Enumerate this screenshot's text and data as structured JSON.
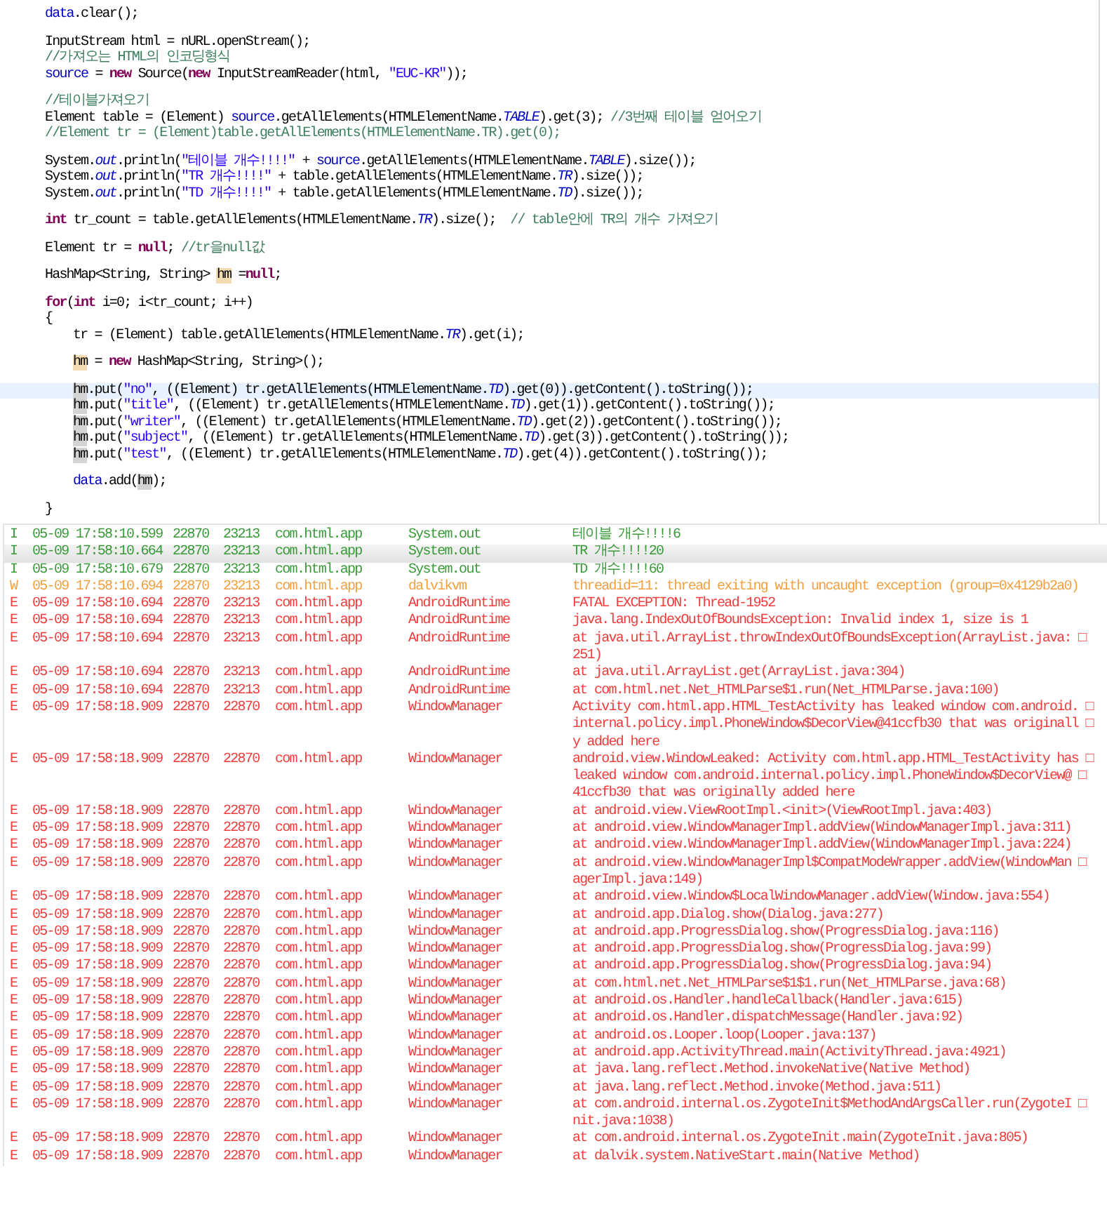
{
  "editor": {
    "lines": [
      {
        "kind": "code",
        "current": false,
        "tokens": [
          {
            "kind": "field",
            "t": "data"
          },
          {
            "kind": "plain",
            "t": ".clear();"
          }
        ]
      },
      {
        "kind": "blank"
      },
      {
        "kind": "code",
        "current": false,
        "tokens": [
          {
            "kind": "plain",
            "t": "InputStream html = nURL.openStream();"
          }
        ]
      },
      {
        "kind": "code",
        "current": false,
        "tokens": [
          {
            "kind": "comment",
            "t": "//가져오는 HTML의 인코딩형식"
          }
        ]
      },
      {
        "kind": "code",
        "current": false,
        "tokens": [
          {
            "kind": "field",
            "t": "source"
          },
          {
            "kind": "plain",
            "t": " = "
          },
          {
            "kind": "keyword",
            "t": "new"
          },
          {
            "kind": "plain",
            "t": " Source("
          },
          {
            "kind": "keyword",
            "t": "new"
          },
          {
            "kind": "plain",
            "t": " InputStreamReader(html, "
          },
          {
            "kind": "string",
            "t": "\"EUC-KR\""
          },
          {
            "kind": "plain",
            "t": "));"
          }
        ]
      },
      {
        "kind": "blank"
      },
      {
        "kind": "code",
        "current": false,
        "tokens": [
          {
            "kind": "comment",
            "t": "//테이블가져오기"
          }
        ]
      },
      {
        "kind": "code",
        "current": false,
        "tokens": [
          {
            "kind": "plain",
            "t": "Element table = (Element) "
          },
          {
            "kind": "field",
            "t": "source"
          },
          {
            "kind": "plain",
            "t": ".getAllElements(HTMLElementName."
          },
          {
            "kind": "static",
            "t": "TABLE"
          },
          {
            "kind": "plain",
            "t": ").get(3); "
          },
          {
            "kind": "comment",
            "t": "//3번째 테이블 얻어오기"
          }
        ]
      },
      {
        "kind": "code",
        "current": false,
        "tokens": [
          {
            "kind": "comment",
            "t": "//Element tr = (Element)table.getAllElements(HTMLElementName.TR).get(0);"
          }
        ]
      },
      {
        "kind": "blank"
      },
      {
        "kind": "code",
        "current": false,
        "tokens": [
          {
            "kind": "plain",
            "t": "System."
          },
          {
            "kind": "static",
            "t": "out"
          },
          {
            "kind": "plain",
            "t": ".println("
          },
          {
            "kind": "string",
            "t": "\"테이블 개수!!!!\""
          },
          {
            "kind": "plain",
            "t": " + "
          },
          {
            "kind": "field",
            "t": "source"
          },
          {
            "kind": "plain",
            "t": ".getAllElements(HTMLElementName."
          },
          {
            "kind": "static",
            "t": "TABLE"
          },
          {
            "kind": "plain",
            "t": ").size());"
          }
        ]
      },
      {
        "kind": "code",
        "current": false,
        "tokens": [
          {
            "kind": "plain",
            "t": "System."
          },
          {
            "kind": "static",
            "t": "out"
          },
          {
            "kind": "plain",
            "t": ".println("
          },
          {
            "kind": "string",
            "t": "\"TR 개수!!!!\""
          },
          {
            "kind": "plain",
            "t": " + table.getAllElements(HTMLElementName."
          },
          {
            "kind": "static",
            "t": "TR"
          },
          {
            "kind": "plain",
            "t": ").size());"
          }
        ]
      },
      {
        "kind": "code",
        "current": false,
        "tokens": [
          {
            "kind": "plain",
            "t": "System."
          },
          {
            "kind": "static",
            "t": "out"
          },
          {
            "kind": "plain",
            "t": ".println("
          },
          {
            "kind": "string",
            "t": "\"TD 개수!!!!\""
          },
          {
            "kind": "plain",
            "t": " + table.getAllElements(HTMLElementName."
          },
          {
            "kind": "static",
            "t": "TD"
          },
          {
            "kind": "plain",
            "t": ").size());"
          }
        ]
      },
      {
        "kind": "blank"
      },
      {
        "kind": "code",
        "current": false,
        "tokens": [
          {
            "kind": "keyword",
            "t": "int"
          },
          {
            "kind": "plain",
            "t": " tr_count = table.getAllElements(HTMLElementName."
          },
          {
            "kind": "static",
            "t": "TR"
          },
          {
            "kind": "plain",
            "t": ").size();  "
          },
          {
            "kind": "comment",
            "t": "// table안에 TR의 개수 가져오기"
          }
        ]
      },
      {
        "kind": "blank"
      },
      {
        "kind": "code",
        "current": false,
        "tokens": [
          {
            "kind": "plain",
            "t": "Element tr = "
          },
          {
            "kind": "keyword",
            "t": "null"
          },
          {
            "kind": "plain",
            "t": "; "
          },
          {
            "kind": "comment",
            "t": "//tr을null값"
          }
        ]
      },
      {
        "kind": "blank"
      },
      {
        "kind": "code",
        "current": false,
        "tokens": [
          {
            "kind": "plain",
            "t": "HashMap<String, String> "
          },
          {
            "kind": "declaration",
            "t": "hm"
          },
          {
            "kind": "plain",
            "t": " ="
          },
          {
            "kind": "keyword",
            "t": "null"
          },
          {
            "kind": "plain",
            "t": ";"
          }
        ]
      },
      {
        "kind": "blank"
      },
      {
        "kind": "code",
        "current": false,
        "tokens": [
          {
            "kind": "keyword",
            "t": "for"
          },
          {
            "kind": "plain",
            "t": "("
          },
          {
            "kind": "keyword",
            "t": "int"
          },
          {
            "kind": "plain",
            "t": " i=0; i<tr_count; i++)"
          }
        ]
      },
      {
        "kind": "code",
        "current": false,
        "tokens": [
          {
            "kind": "plain",
            "t": "{"
          }
        ]
      },
      {
        "kind": "indented",
        "current": false,
        "tokens": [
          {
            "kind": "plain",
            "t": "tr = (Element) table.getAllElements(HTMLElementName."
          },
          {
            "kind": "static",
            "t": "TR"
          },
          {
            "kind": "plain",
            "t": ").get(i);"
          }
        ]
      },
      {
        "kind": "blank"
      },
      {
        "kind": "indented",
        "current": false,
        "tokens": [
          {
            "kind": "declaration",
            "t": "hm"
          },
          {
            "kind": "plain",
            "t": " = "
          },
          {
            "kind": "keyword",
            "t": "new"
          },
          {
            "kind": "plain",
            "t": " HashMap<String, String>();"
          }
        ]
      },
      {
        "kind": "blank"
      },
      {
        "kind": "indented",
        "current": true,
        "tokens": [
          {
            "kind": "occurrence",
            "t": "hm"
          },
          {
            "kind": "plain",
            "t": ".put("
          },
          {
            "kind": "string",
            "t": "\"no\""
          },
          {
            "kind": "plain",
            "t": ", ((Element) tr.getAllElements(HTMLElementName."
          },
          {
            "kind": "static",
            "t": "TD"
          },
          {
            "kind": "plain",
            "t": ").get(0)).getContent().toString());"
          }
        ]
      },
      {
        "kind": "indented",
        "current": false,
        "tokens": [
          {
            "kind": "occurrence",
            "t": "hm"
          },
          {
            "kind": "plain",
            "t": ".put("
          },
          {
            "kind": "string",
            "t": "\"title\""
          },
          {
            "kind": "plain",
            "t": ", ((Element) tr.getAllElements(HTMLElementName."
          },
          {
            "kind": "static",
            "t": "TD"
          },
          {
            "kind": "plain",
            "t": ").get(1)).getContent().toString());"
          }
        ]
      },
      {
        "kind": "indented",
        "current": false,
        "tokens": [
          {
            "kind": "occurrence",
            "t": "hm"
          },
          {
            "kind": "plain",
            "t": ".put("
          },
          {
            "kind": "string",
            "t": "\"writer\""
          },
          {
            "kind": "plain",
            "t": ", ((Element) tr.getAllElements(HTMLElementName."
          },
          {
            "kind": "static",
            "t": "TD"
          },
          {
            "kind": "plain",
            "t": ").get(2)).getContent().toString());"
          }
        ]
      },
      {
        "kind": "indented",
        "current": false,
        "tokens": [
          {
            "kind": "occurrence",
            "t": "hm"
          },
          {
            "kind": "plain",
            "t": ".put("
          },
          {
            "kind": "string",
            "t": "\"subject\""
          },
          {
            "kind": "plain",
            "t": ", ((Element) tr.getAllElements(HTMLElementName."
          },
          {
            "kind": "static",
            "t": "TD"
          },
          {
            "kind": "plain",
            "t": ").get(3)).getContent().toString());"
          }
        ]
      },
      {
        "kind": "indented",
        "current": false,
        "tokens": [
          {
            "kind": "occurrence",
            "t": "hm"
          },
          {
            "kind": "plain",
            "t": ".put("
          },
          {
            "kind": "string",
            "t": "\"test\""
          },
          {
            "kind": "plain",
            "t": ", ((Element) tr.getAllElements(HTMLElementName."
          },
          {
            "kind": "static",
            "t": "TD"
          },
          {
            "kind": "plain",
            "t": ").get(4)).getContent().toString());"
          }
        ]
      },
      {
        "kind": "blank"
      },
      {
        "kind": "indented",
        "current": false,
        "tokens": [
          {
            "kind": "field",
            "t": "data"
          },
          {
            "kind": "plain",
            "t": ".add("
          },
          {
            "kind": "occurrence",
            "t": "hm"
          },
          {
            "kind": "plain",
            "t": ");"
          }
        ]
      },
      {
        "kind": "blank"
      },
      {
        "kind": "code",
        "current": false,
        "tokens": [
          {
            "kind": "plain",
            "t": "}"
          }
        ]
      }
    ]
  },
  "logcat": {
    "rows": [
      {
        "selected": false,
        "color": "#3a9a3a",
        "level": "I",
        "time": "05-09 17:58:10.599",
        "pid": "22870",
        "tid": "23213",
        "application": "com.html.app",
        "tag": "System.out",
        "text": [
          "테이블 개수!!!!6"
        ]
      },
      {
        "selected": true,
        "color": "#3a9a3a",
        "level": "I",
        "time": "05-09 17:58:10.664",
        "pid": "22870",
        "tid": "23213",
        "application": "com.html.app",
        "tag": "System.out",
        "text": [
          "TR 개수!!!!20"
        ]
      },
      {
        "selected": false,
        "color": "#3a9a3a",
        "level": "I",
        "time": "05-09 17:58:10.679",
        "pid": "22870",
        "tid": "23213",
        "application": "com.html.app",
        "tag": "System.out",
        "text": [
          "TD 개수!!!!60"
        ]
      },
      {
        "selected": false,
        "color": "#f0a040",
        "level": "W",
        "time": "05-09 17:58:10.694",
        "pid": "22870",
        "tid": "23213",
        "application": "com.html.app",
        "tag": "dalvikvm",
        "text": [
          "threadid=11: thread exiting with uncaught exception (group=0x4129b2a0)"
        ]
      },
      {
        "selected": false,
        "color": "#f03c3c",
        "level": "E",
        "time": "05-09 17:58:10.694",
        "pid": "22870",
        "tid": "23213",
        "application": "com.html.app",
        "tag": "AndroidRuntime",
        "text": [
          "FATAL EXCEPTION: Thread-1952"
        ]
      },
      {
        "selected": false,
        "color": "#f03c3c",
        "level": "E",
        "time": "05-09 17:58:10.694",
        "pid": "22870",
        "tid": "23213",
        "application": "com.html.app",
        "tag": "AndroidRuntime",
        "text": [
          "java.lang.IndexOutOfBoundsException: Invalid index 1, size is 1"
        ]
      },
      {
        "selected": false,
        "color": "#f03c3c",
        "level": "E",
        "time": "05-09 17:58:10.694",
        "pid": "22870",
        "tid": "23213",
        "application": "com.html.app",
        "tag": "AndroidRuntime",
        "text": [
          "at java.util.ArrayList.throwIndexOutOfBoundsException(ArrayList.java: □",
          "251)"
        ]
      },
      {
        "selected": false,
        "color": "#f03c3c",
        "level": "E",
        "time": "05-09 17:58:10.694",
        "pid": "22870",
        "tid": "23213",
        "application": "com.html.app",
        "tag": "AndroidRuntime",
        "text": [
          "at java.util.ArrayList.get(ArrayList.java:304)"
        ]
      },
      {
        "selected": false,
        "color": "#f03c3c",
        "level": "E",
        "time": "05-09 17:58:10.694",
        "pid": "22870",
        "tid": "23213",
        "application": "com.html.app",
        "tag": "AndroidRuntime",
        "text": [
          "at com.html.net.Net_HTMLParse$1.run(Net_HTMLParse.java:100)"
        ]
      },
      {
        "selected": false,
        "color": "#f03c3c",
        "level": "E",
        "time": "05-09 17:58:18.909",
        "pid": "22870",
        "tid": "22870",
        "application": "com.html.app",
        "tag": "WindowManager",
        "text": [
          "Activity com.html.app.HTML_TestActivity has leaked window com.android. □",
          "internal.policy.impl.PhoneWindow$DecorView@41ccfb30 that was originall □",
          "y added here"
        ]
      },
      {
        "selected": false,
        "color": "#f03c3c",
        "level": "E",
        "time": "05-09 17:58:18.909",
        "pid": "22870",
        "tid": "22870",
        "application": "com.html.app",
        "tag": "WindowManager",
        "text": [
          "android.view.WindowLeaked: Activity com.html.app.HTML_TestActivity has □",
          "leaked window com.android.internal.policy.impl.PhoneWindow$DecorView@ □",
          "41ccfb30 that was originally added here"
        ]
      },
      {
        "selected": false,
        "color": "#f03c3c",
        "level": "E",
        "time": "05-09 17:58:18.909",
        "pid": "22870",
        "tid": "22870",
        "application": "com.html.app",
        "tag": "WindowManager",
        "text": [
          "at android.view.ViewRootImpl.<init>(ViewRootImpl.java:403)"
        ]
      },
      {
        "selected": false,
        "color": "#f03c3c",
        "level": "E",
        "time": "05-09 17:58:18.909",
        "pid": "22870",
        "tid": "22870",
        "application": "com.html.app",
        "tag": "WindowManager",
        "text": [
          "at android.view.WindowManagerImpl.addView(WindowManagerImpl.java:311)"
        ]
      },
      {
        "selected": false,
        "color": "#f03c3c",
        "level": "E",
        "time": "05-09 17:58:18.909",
        "pid": "22870",
        "tid": "22870",
        "application": "com.html.app",
        "tag": "WindowManager",
        "text": [
          "at android.view.WindowManagerImpl.addView(WindowManagerImpl.java:224)"
        ]
      },
      {
        "selected": false,
        "color": "#f03c3c",
        "level": "E",
        "time": "05-09 17:58:18.909",
        "pid": "22870",
        "tid": "22870",
        "application": "com.html.app",
        "tag": "WindowManager",
        "text": [
          "at android.view.WindowManagerImpl$CompatModeWrapper.addView(WindowMan □",
          "agerImpl.java:149)"
        ]
      },
      {
        "selected": false,
        "color": "#f03c3c",
        "level": "E",
        "time": "05-09 17:58:18.909",
        "pid": "22870",
        "tid": "22870",
        "application": "com.html.app",
        "tag": "WindowManager",
        "text": [
          "at android.view.Window$LocalWindowManager.addView(Window.java:554)"
        ]
      },
      {
        "selected": false,
        "color": "#f03c3c",
        "level": "E",
        "time": "05-09 17:58:18.909",
        "pid": "22870",
        "tid": "22870",
        "application": "com.html.app",
        "tag": "WindowManager",
        "text": [
          "at android.app.Dialog.show(Dialog.java:277)"
        ]
      },
      {
        "selected": false,
        "color": "#f03c3c",
        "level": "E",
        "time": "05-09 17:58:18.909",
        "pid": "22870",
        "tid": "22870",
        "application": "com.html.app",
        "tag": "WindowManager",
        "text": [
          "at android.app.ProgressDialog.show(ProgressDialog.java:116)"
        ]
      },
      {
        "selected": false,
        "color": "#f03c3c",
        "level": "E",
        "time": "05-09 17:58:18.909",
        "pid": "22870",
        "tid": "22870",
        "application": "com.html.app",
        "tag": "WindowManager",
        "text": [
          "at android.app.ProgressDialog.show(ProgressDialog.java:99)"
        ]
      },
      {
        "selected": false,
        "color": "#f03c3c",
        "level": "E",
        "time": "05-09 17:58:18.909",
        "pid": "22870",
        "tid": "22870",
        "application": "com.html.app",
        "tag": "WindowManager",
        "text": [
          "at android.app.ProgressDialog.show(ProgressDialog.java:94)"
        ]
      },
      {
        "selected": false,
        "color": "#f03c3c",
        "level": "E",
        "time": "05-09 17:58:18.909",
        "pid": "22870",
        "tid": "22870",
        "application": "com.html.app",
        "tag": "WindowManager",
        "text": [
          "at com.html.net.Net_HTMLParse$1$1.run(Net_HTMLParse.java:68)"
        ]
      },
      {
        "selected": false,
        "color": "#f03c3c",
        "level": "E",
        "time": "05-09 17:58:18.909",
        "pid": "22870",
        "tid": "22870",
        "application": "com.html.app",
        "tag": "WindowManager",
        "text": [
          "at android.os.Handler.handleCallback(Handler.java:615)"
        ]
      },
      {
        "selected": false,
        "color": "#f03c3c",
        "level": "E",
        "time": "05-09 17:58:18.909",
        "pid": "22870",
        "tid": "22870",
        "application": "com.html.app",
        "tag": "WindowManager",
        "text": [
          "at android.os.Handler.dispatchMessage(Handler.java:92)"
        ]
      },
      {
        "selected": false,
        "color": "#f03c3c",
        "level": "E",
        "time": "05-09 17:58:18.909",
        "pid": "22870",
        "tid": "22870",
        "application": "com.html.app",
        "tag": "WindowManager",
        "text": [
          "at android.os.Looper.loop(Looper.java:137)"
        ]
      },
      {
        "selected": false,
        "color": "#f03c3c",
        "level": "E",
        "time": "05-09 17:58:18.909",
        "pid": "22870",
        "tid": "22870",
        "application": "com.html.app",
        "tag": "WindowManager",
        "text": [
          "at android.app.ActivityThread.main(ActivityThread.java:4921)"
        ]
      },
      {
        "selected": false,
        "color": "#f03c3c",
        "level": "E",
        "time": "05-09 17:58:18.909",
        "pid": "22870",
        "tid": "22870",
        "application": "com.html.app",
        "tag": "WindowManager",
        "text": [
          "at java.lang.reflect.Method.invokeNative(Native Method)"
        ]
      },
      {
        "selected": false,
        "color": "#f03c3c",
        "level": "E",
        "time": "05-09 17:58:18.909",
        "pid": "22870",
        "tid": "22870",
        "application": "com.html.app",
        "tag": "WindowManager",
        "text": [
          "at java.lang.reflect.Method.invoke(Method.java:511)"
        ]
      },
      {
        "selected": false,
        "color": "#f03c3c",
        "level": "E",
        "time": "05-09 17:58:18.909",
        "pid": "22870",
        "tid": "22870",
        "application": "com.html.app",
        "tag": "WindowManager",
        "text": [
          "at com.android.internal.os.ZygoteInit$MethodAndArgsCaller.run(ZygoteI □",
          "nit.java:1038)"
        ]
      },
      {
        "selected": false,
        "color": "#f03c3c",
        "level": "E",
        "time": "05-09 17:58:18.909",
        "pid": "22870",
        "tid": "22870",
        "application": "com.html.app",
        "tag": "WindowManager",
        "text": [
          "at com.android.internal.os.ZygoteInit.main(ZygoteInit.java:805)"
        ]
      },
      {
        "selected": false,
        "color": "#f03c3c",
        "level": "E",
        "time": "05-09 17:58:18.909",
        "pid": "22870",
        "tid": "22870",
        "application": "com.html.app",
        "tag": "WindowManager",
        "text": [
          "at dalvik.system.NativeStart.main(Native Method)"
        ]
      }
    ]
  }
}
